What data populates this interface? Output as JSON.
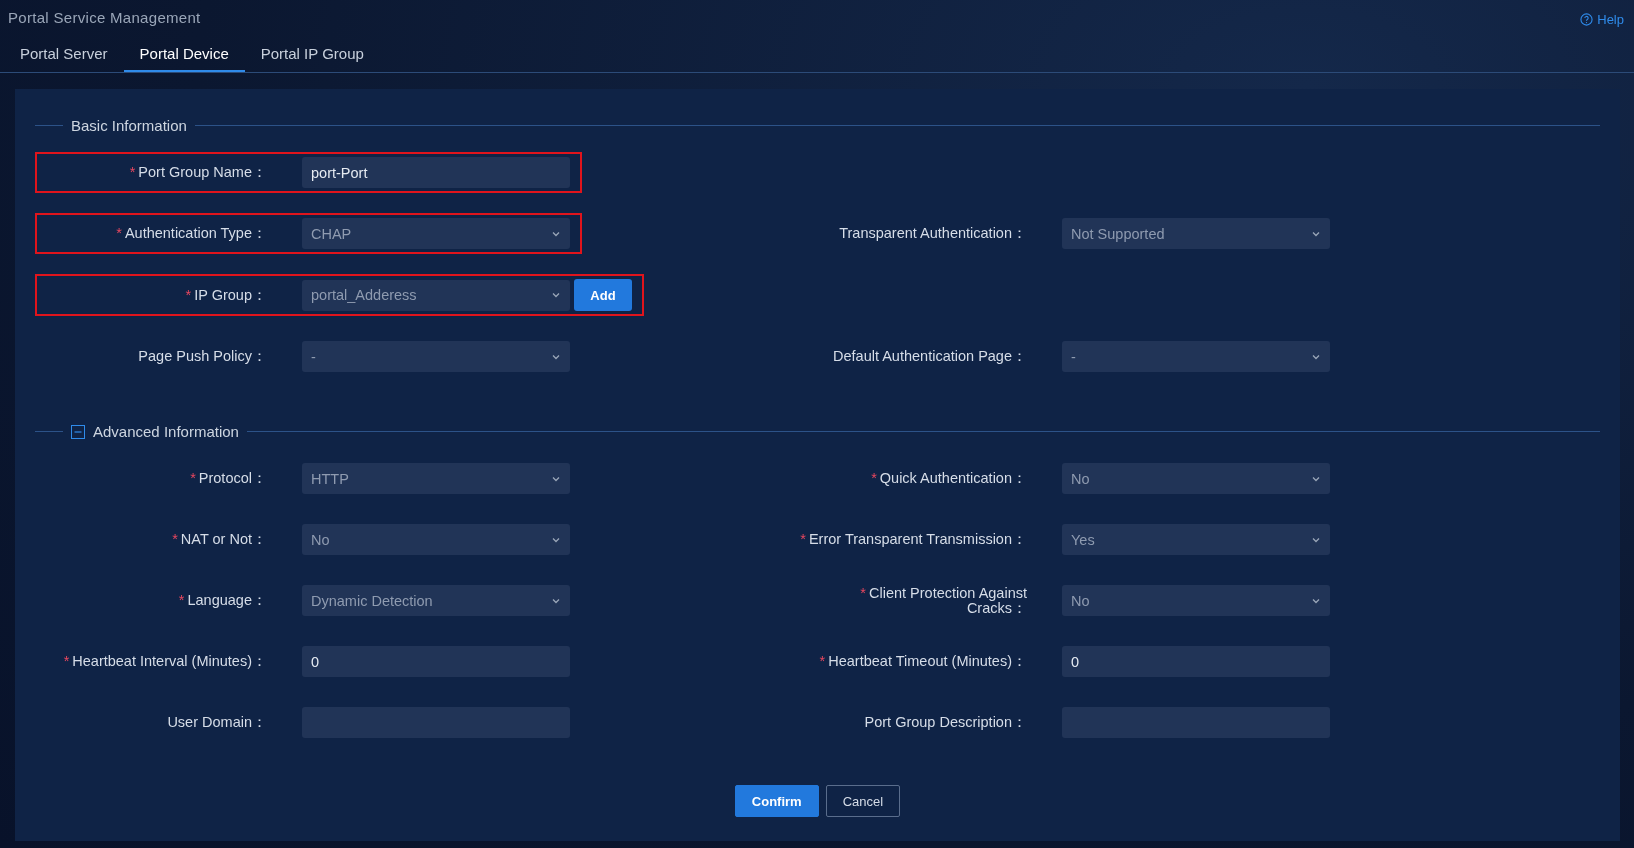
{
  "page": {
    "title": "Portal Service Management",
    "help": "Help"
  },
  "tabs": [
    {
      "label": "Portal Server",
      "selected": false
    },
    {
      "label": "Portal Device",
      "selected": true
    },
    {
      "label": "Portal IP Group",
      "selected": false
    }
  ],
  "sections": [
    {
      "title": "Basic Information",
      "rows": [
        [
          {
            "mark": "*",
            "label": "Port Group Name：",
            "kind": "input",
            "value": "port-Port",
            "highlighted": true
          },
          null
        ],
        [
          {
            "mark": "*",
            "label": "Authentication Type：",
            "kind": "select",
            "value": "CHAP",
            "highlighted": true
          },
          {
            "label": "Transparent Authentication：",
            "kind": "select",
            "value": "Not Supported",
            "highlighted": false
          }
        ],
        [
          {
            "mark": "*",
            "label": "IP Group：",
            "kind": "select",
            "value": "portal_Adderess",
            "highlighted": true,
            "button": "Add"
          },
          null
        ],
        [
          {
            "label": "Page Push Policy：",
            "kind": "select",
            "value": "-",
            "highlighted": false
          },
          {
            "label": "Default Authentication Page：",
            "kind": "select",
            "value": "-",
            "highlighted": false
          }
        ]
      ]
    },
    {
      "title": "Advanced Information",
      "expanded": true,
      "rows": [
        [
          {
            "mark": "*",
            "label": "Protocol：",
            "kind": "select",
            "value": "HTTP",
            "highlighted": false
          },
          {
            "mark": "*",
            "label": "Quick Authentication：",
            "kind": "select",
            "value": "No",
            "highlighted": false
          }
        ],
        [
          {
            "mark": "*",
            "label": "NAT or Not：",
            "kind": "select",
            "value": "No",
            "highlighted": false
          },
          {
            "mark": "*",
            "label": "Error Transparent Transmission：",
            "kind": "select",
            "value": "Yes",
            "highlighted": false
          }
        ],
        [
          {
            "mark": "*",
            "label": "Language：",
            "kind": "select",
            "value": "Dynamic Detection",
            "highlighted": false
          },
          {
            "mark": "*",
            "label": "Client Protection Against Cracks：",
            "kind": "select",
            "value": "No",
            "highlighted": false
          }
        ],
        [
          {
            "mark": "*",
            "label": "Heartbeat Interval (Minutes)：",
            "kind": "input",
            "value": "0",
            "highlighted": false
          },
          {
            "mark": "*",
            "label": "Heartbeat Timeout (Minutes)：",
            "kind": "input",
            "value": "0",
            "highlighted": false
          }
        ],
        [
          {
            "label": "User Domain：",
            "kind": "input",
            "highlighted": false
          },
          {
            "label": "Port Group Description：",
            "kind": "input",
            "highlighted": false
          }
        ]
      ]
    }
  ],
  "buttons": [
    {
      "label": "Confirm",
      "kind": "primary"
    },
    {
      "label": "Cancel",
      "kind": "secondary"
    }
  ]
}
